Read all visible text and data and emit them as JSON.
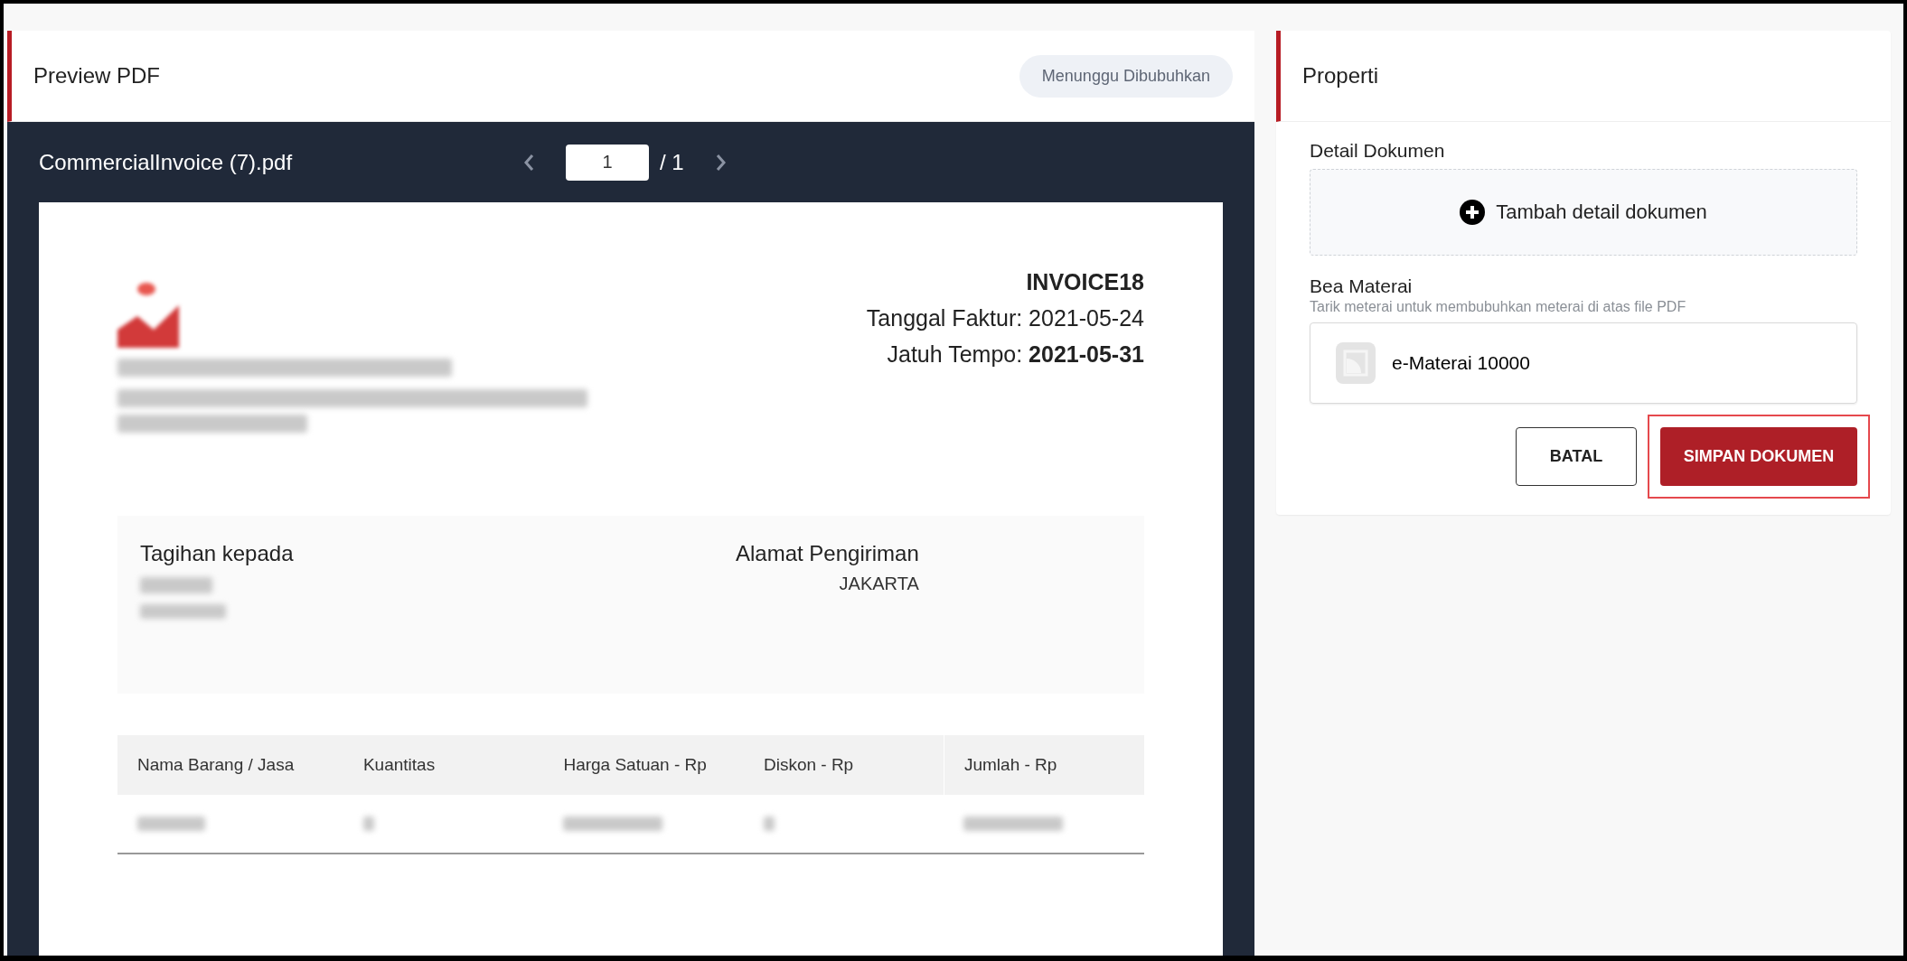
{
  "preview": {
    "title": "Preview PDF",
    "status": "Menunggu Dibubuhkan"
  },
  "viewer": {
    "filename": "CommercialInvoice (7).pdf",
    "page": "1",
    "total": "/ 1"
  },
  "invoice": {
    "number": "INVOICE18",
    "date_line": "Tanggal Faktur: 2021-05-24",
    "due_line": "Jatuh Tempo: **2021-05-31**",
    "bill_to": {
      "title": "Tagihan kepada"
    },
    "ship_to": {
      "title": "Alamat Pengiriman",
      "lines": [
        "JAKARTA"
      ]
    },
    "table": {
      "columns": [
        "Nama Barang / Jasa",
        "Kuantitas",
        "Harga Satuan - Rp",
        "Diskon - Rp",
        "Jumlah - Rp"
      ]
    }
  },
  "properti": {
    "title": "Properti",
    "detail_label": "Detail Dokumen",
    "add_detail": "Tambah detail dokumen",
    "stamp_label": "Bea Materai",
    "stamp_hint": "Tarik meterai untuk membubuhkan meterai di atas file PDF",
    "stamps": [
      {
        "name": "e-Materai 10000"
      }
    ],
    "buttons": [
      {
        "label": "BATAL",
        "kind": "secondary",
        "highlighted": false
      },
      {
        "label": "SIMPAN DOKUMEN",
        "kind": "primary",
        "highlighted": true
      }
    ]
  }
}
